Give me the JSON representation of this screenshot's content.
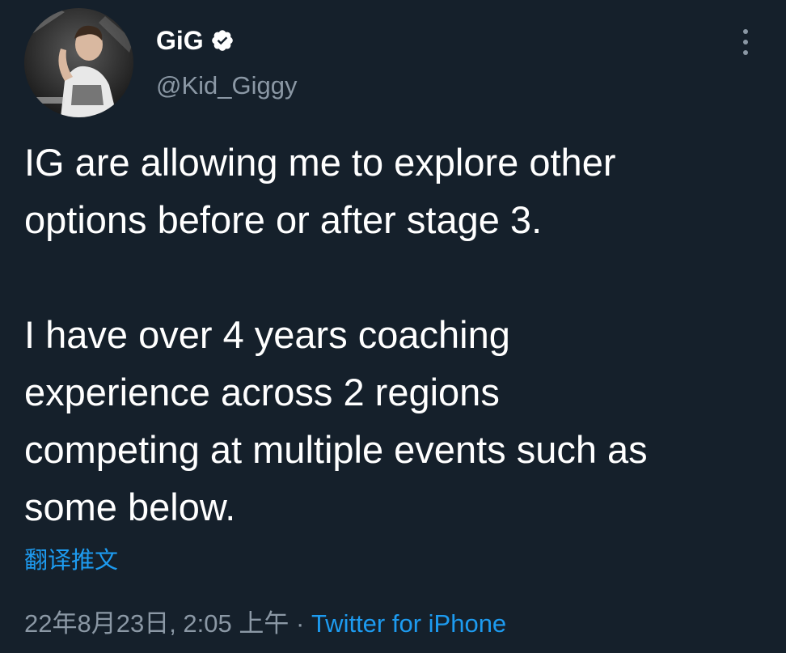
{
  "author": {
    "display_name": "GiG",
    "handle": "@Kid_Giggy",
    "avatar_icon": "avatar-photo",
    "verified_icon": "verified-badge-icon"
  },
  "more_icon": "more-options-icon",
  "tweet": {
    "paragraph_1": "IG are allowing me to explore other\noptions before or after stage 3.",
    "paragraph_2": "I have over 4 years coaching\nexperience across 2 regions\ncompeting at multiple events such as\nsome below."
  },
  "translate_label": "翻译推文",
  "meta": {
    "timestamp": "22年8月23日, 2:05 上午",
    "separator": " · ",
    "source": "Twitter for iPhone"
  },
  "colors": {
    "background": "#15202b",
    "text": "#ffffff",
    "secondary": "#8b98a5",
    "link": "#1d9bf0"
  }
}
